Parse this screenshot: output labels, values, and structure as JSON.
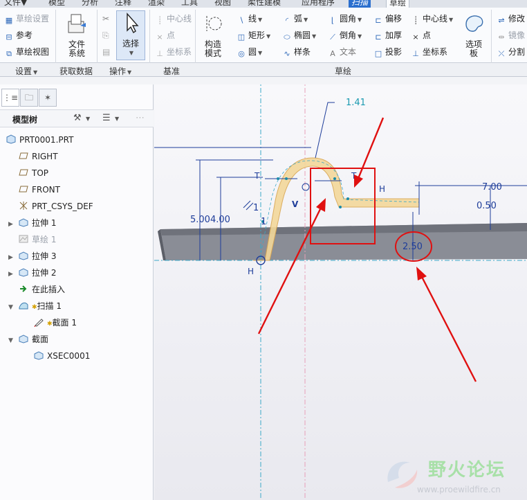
{
  "menubar": {
    "tabs": [
      "文件▼",
      "模型",
      "分析",
      "注释",
      "渲染",
      "工具",
      "视图",
      "柔性建模",
      "应用程序",
      "扫描",
      "草绘"
    ]
  },
  "ribbon": {
    "settings": {
      "sketch_setup": "草绘设置",
      "references": "参考",
      "sketch_view": "草绘视图",
      "group": "设置"
    },
    "get_data": {
      "file_system": "文件\n系统",
      "group": "获取数据"
    },
    "operations": {
      "select": "选择",
      "group": "操作"
    },
    "datum": {
      "centerline": "中心线",
      "point": "点",
      "csys": "坐标系",
      "group": "基准"
    },
    "sketch": {
      "construction_mode": "构造\n模式",
      "line": "线",
      "rectangle": "矩形",
      "circle": "圆",
      "arc": "弧",
      "ellipse": "椭圆",
      "spline": "样条",
      "fillet": "圆角",
      "chamfer": "倒角",
      "text": "文本",
      "offset": "偏移",
      "thicken": "加厚",
      "project": "投影",
      "centerline": "中心线",
      "point": "点",
      "csys": "坐标系",
      "palette": "选项\n板",
      "group": "草绘"
    },
    "editing": {
      "modify": "修改",
      "mirror": "镜像",
      "divide": "分割"
    }
  },
  "model_tree": {
    "title": "模型树",
    "items": [
      {
        "label": "PRT0001.PRT"
      },
      {
        "label": "RIGHT"
      },
      {
        "label": "TOP"
      },
      {
        "label": "FRONT"
      },
      {
        "label": "PRT_CSYS_DEF"
      },
      {
        "label": "拉伸 1"
      },
      {
        "label": "草绘 1"
      },
      {
        "label": "拉伸 3"
      },
      {
        "label": "拉伸 2"
      },
      {
        "label": "在此插入"
      },
      {
        "label": "扫描 1"
      },
      {
        "label": "截面 1"
      },
      {
        "label": "截面"
      },
      {
        "label": "XSEC0001"
      }
    ]
  },
  "sketch": {
    "dims": {
      "d141": "1.41",
      "d5004": "5.004.00",
      "d700": "7.00",
      "d050": "0.50",
      "d250": "2.50",
      "d1a": "1",
      "d1b": "1"
    },
    "constraints": {
      "T1": "T",
      "T2": "T",
      "H1": "H",
      "H2": "H",
      "V": "V"
    }
  },
  "watermark": {
    "name": "野火论坛",
    "url": "www.proewildfire.cn"
  },
  "colors": {
    "annotation_red": "#e01010",
    "dimension_blue": "#1e3d9a",
    "sweep_section": "#f3d89a",
    "accent": "#2b6fce"
  }
}
